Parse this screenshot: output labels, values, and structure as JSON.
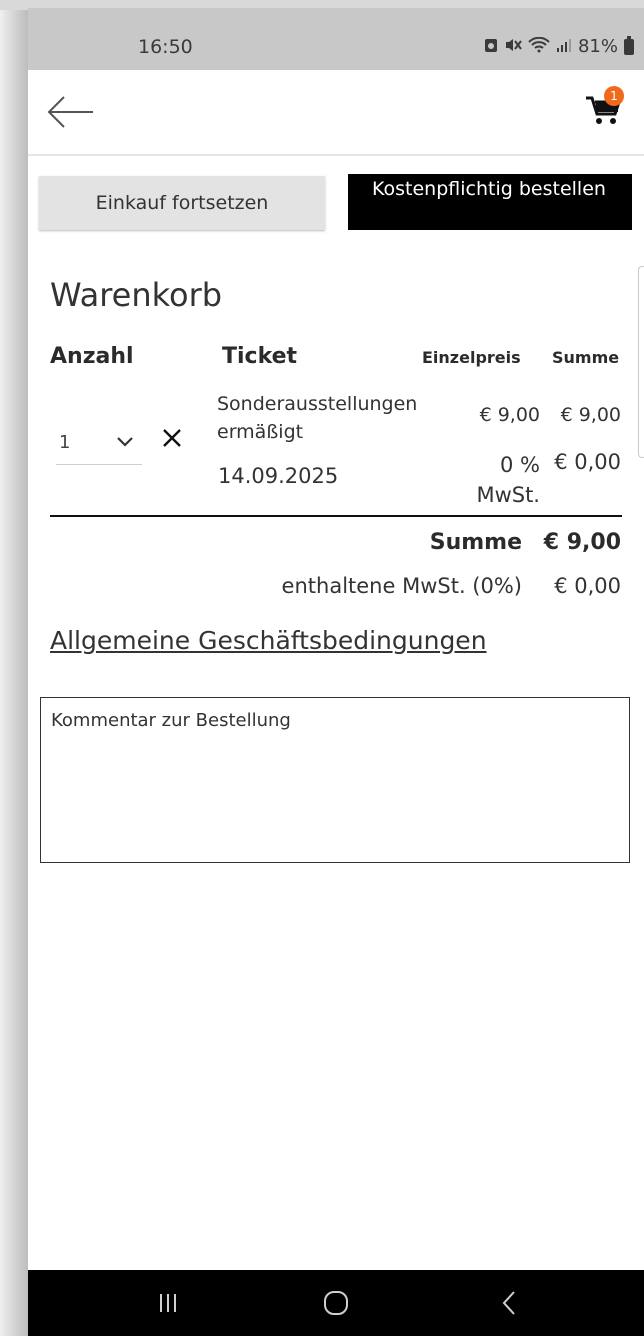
{
  "status": {
    "time": "16:50",
    "battery": "81%"
  },
  "header": {
    "cart_count": "1"
  },
  "actions": {
    "continue_label": "Einkauf fortsetzen",
    "order_label": "Kostenpflichtig bestellen"
  },
  "cart": {
    "title": "Warenkorb",
    "columns": {
      "quantity": "Anzahl",
      "ticket": "Ticket",
      "unit_price": "Einzelpreis",
      "sum": "Summe"
    },
    "items": [
      {
        "quantity": "1",
        "name": "Sonderausstellungen ermäßigt",
        "date": "14.09.2025",
        "unit_price": "€ 9,00",
        "line_sum": "€ 9,00",
        "vat_label": "0 % MwSt.",
        "vat_amount": "€ 0,00"
      }
    ],
    "totals": {
      "sum_label": "Summe",
      "sum_value": "€ 9,00",
      "vat_label": "enthaltene MwSt. (0%)",
      "vat_value": "€ 0,00"
    }
  },
  "links": {
    "terms": "Allgemeine Geschäftsbedingungen"
  },
  "comment": {
    "placeholder": "Kommentar zur Bestellung",
    "value": ""
  },
  "colors": {
    "accent": "#ef6a1a",
    "primary_button": "#000000",
    "secondary_button": "#e3e3e3"
  },
  "icons": [
    "back-arrow-icon",
    "shopping-cart-icon",
    "chevron-down-icon",
    "close-icon",
    "recent-apps-icon",
    "home-icon",
    "back-icon"
  ]
}
